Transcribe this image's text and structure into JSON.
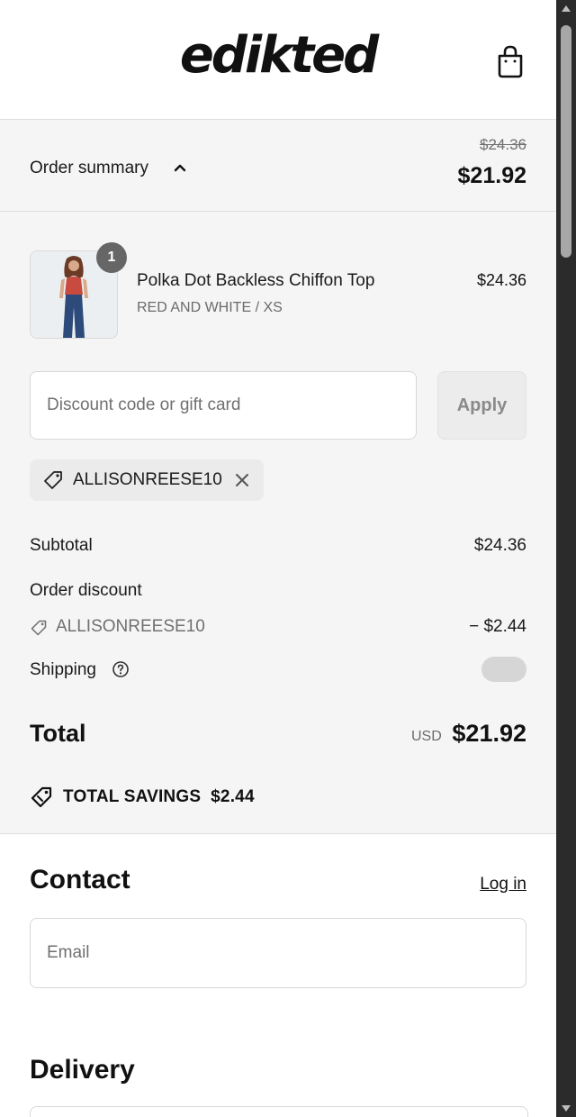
{
  "header": {
    "brand": "edikted",
    "cart_icon": "shopping-bag-icon"
  },
  "summary_bar": {
    "label": "Order summary",
    "original_price": "$24.36",
    "total": "$21.92"
  },
  "line_items": [
    {
      "quantity": "1",
      "name": "Polka Dot Backless Chiffon Top",
      "variant": "RED AND WHITE / XS",
      "price": "$24.36"
    }
  ],
  "discount": {
    "placeholder": "Discount code or gift card",
    "value": "",
    "apply_label": "Apply",
    "applied_code": "ALLISONREESE10"
  },
  "totals": {
    "subtotal_label": "Subtotal",
    "subtotal_value": "$24.36",
    "discount_label": "Order discount",
    "discount_code": "ALLISONREESE10",
    "discount_value": "− $2.44",
    "shipping_label": "Shipping",
    "total_label": "Total",
    "currency": "USD",
    "total_value": "$21.92",
    "savings_label": "TOTAL SAVINGS  $2.44"
  },
  "contact": {
    "title": "Contact",
    "login_label": "Log in",
    "email_placeholder": "Email",
    "email_value": ""
  },
  "delivery": {
    "title": "Delivery"
  },
  "colors": {
    "summary_background": "#f5f5f5",
    "badge": "#666666",
    "border": "#dedede"
  }
}
